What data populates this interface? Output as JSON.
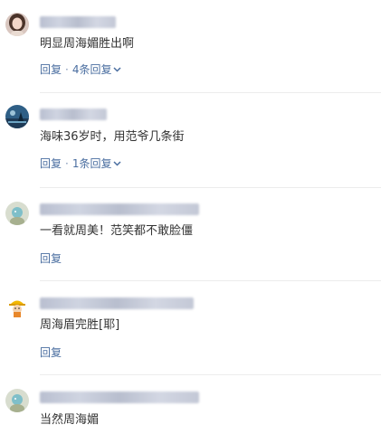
{
  "comments": [
    {
      "text": "明显周海媚胜出啊",
      "reply_label": "回复",
      "replies_label": "4条回复",
      "avatar": "woman-portrait-icon"
    },
    {
      "text": "海味36岁时，用范爷几条街",
      "reply_label": "回复",
      "replies_label": "1条回复",
      "avatar": "beach-scene-icon"
    },
    {
      "text": "一看就周美！范笑都不敢脸僵",
      "reply_label": "回复",
      "avatar": "default-user-icon"
    },
    {
      "text": "周海眉完胜[耶]",
      "reply_label": "回复",
      "avatar": "construction-character-icon"
    },
    {
      "text": "当然周海媚",
      "avatar": "default-user-icon"
    }
  ],
  "colors": {
    "link": "#4a6ea0",
    "text": "#333333",
    "divider": "#ececec"
  }
}
